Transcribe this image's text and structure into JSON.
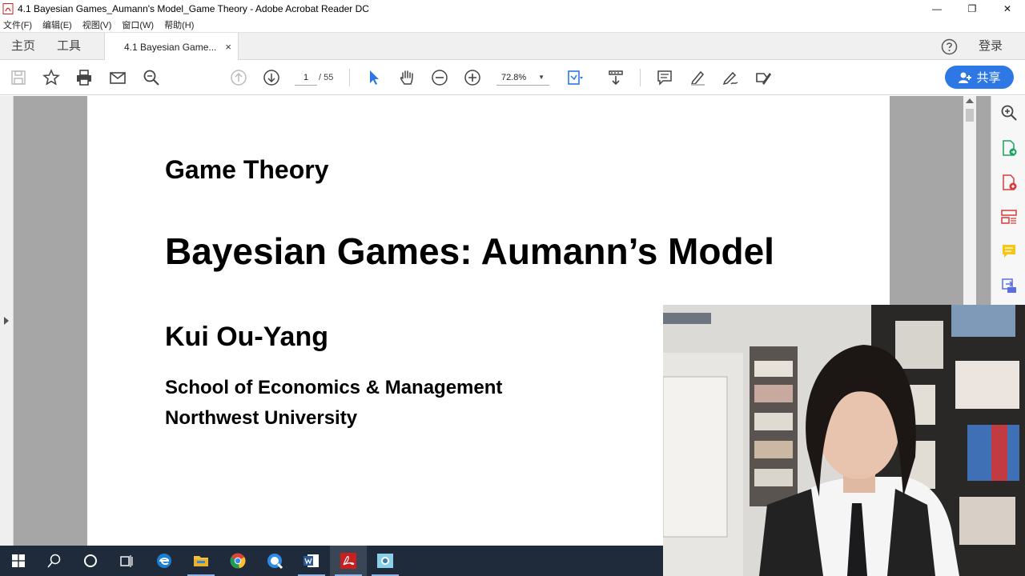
{
  "window": {
    "title": "4.1 Bayesian Games_Aumann's Model_Game Theory - Adobe Acrobat Reader DC",
    "minimize": "—",
    "restore": "❐",
    "close": "✕"
  },
  "menubar": [
    "文件(F)",
    "编辑(E)",
    "视图(V)",
    "窗口(W)",
    "帮助(H)"
  ],
  "tabs": {
    "home": "主页",
    "tools": "工具",
    "document": "4.1 Bayesian Game...",
    "close": "×",
    "login": "登录"
  },
  "toolbar": {
    "page_current": "1",
    "page_total": "/ 55",
    "zoom": "72.8%",
    "share_label": "共享",
    "icons": [
      "save-icon",
      "bookmark-star-icon",
      "print-icon",
      "email-icon",
      "search-icon",
      "page-up-icon",
      "page-down-icon",
      "select-cursor-icon",
      "hand-icon",
      "zoom-out-icon",
      "zoom-in-icon",
      "fit-page-icon",
      "scroll-mode-icon",
      "comment-icon",
      "highlight-icon",
      "sign-icon",
      "fill-sign-icon"
    ]
  },
  "document": {
    "title_small": "Game Theory",
    "title_main": "Bayesian Games: Aumann’s Model",
    "author": "Kui Ou-Yang",
    "affiliation_1": "School of Economics & Management",
    "affiliation_2": "Northwest University"
  },
  "colors": {
    "accent": "#2d78e5",
    "taskbar": "#1f2b3a",
    "doc_background": "#a6a6a6"
  }
}
